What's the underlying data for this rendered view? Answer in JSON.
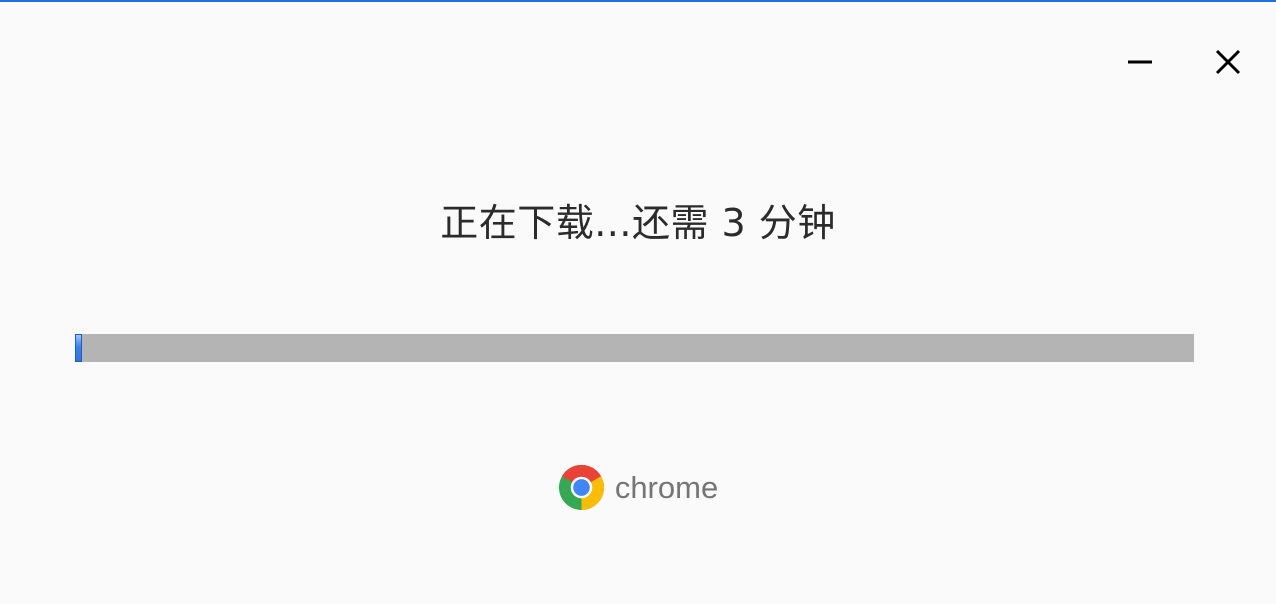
{
  "window": {
    "controls": {
      "minimize_icon": "minimize-icon",
      "close_icon": "close-icon"
    }
  },
  "status": {
    "text": "正在下载...还需 3 分钟"
  },
  "progress": {
    "fraction": 0.006,
    "track_color": "#b4b4b4",
    "fill_color": "#3a82f0"
  },
  "brand": {
    "name": "chrome",
    "logo_icon": "chrome-logo-icon"
  }
}
